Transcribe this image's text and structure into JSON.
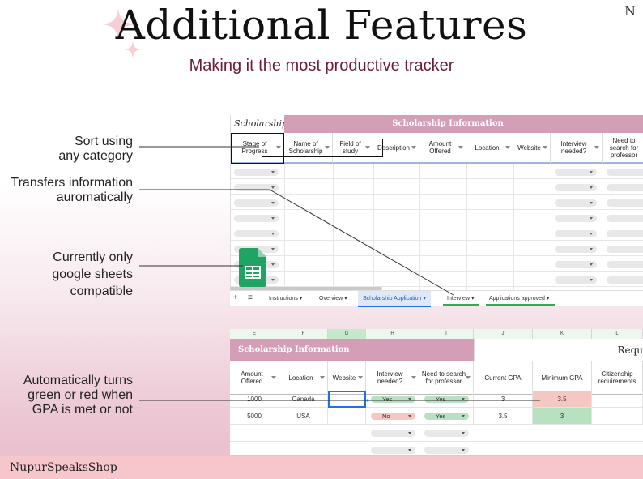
{
  "title": "Additional Features",
  "subtitle": "Making it the most productive tracker",
  "annotations": {
    "sort": [
      "Sort using",
      "any category"
    ],
    "transfer": [
      "Transfers information",
      "auromatically"
    ],
    "compat": [
      "Currently only",
      "google sheets",
      "compatible"
    ],
    "gpa": [
      "Automatically turns",
      "green or red when",
      "GPA is met or not"
    ]
  },
  "sheet1": {
    "logo_text": "Scholarship",
    "banner": "Scholarship Information",
    "headers": [
      "Stage of Progress",
      "Name of Scholarship",
      "Field of study",
      "Description",
      "Amount Offered",
      "Location",
      "Website",
      "Interview needed?",
      "Need to search for professor"
    ]
  },
  "tabs": {
    "add": "+",
    "menu": "≡",
    "items": [
      "Instructions",
      "Overview",
      "Scholarship Application",
      "Interview",
      "Applications approved"
    ]
  },
  "sheet2": {
    "col_letters": [
      "E",
      "F",
      "G",
      "H",
      "I",
      "J",
      "K",
      "L"
    ],
    "banner": "Scholarship Information",
    "banner_right": "Requ",
    "headers": [
      "Amount Offered",
      "Location",
      "Website",
      "Interview needed?",
      "Need to search for professor",
      "Current GPA",
      "Minimum GPA",
      "Citizenship requirements"
    ],
    "rows": [
      {
        "amount": "1000",
        "location": "Canada",
        "website": "",
        "interview": "Yes",
        "professor": "Yes",
        "current_gpa": "3",
        "min_gpa": "3.5",
        "min_status": "unmet"
      },
      {
        "amount": "5000",
        "location": "USA",
        "website": "",
        "interview": "No",
        "professor": "Yes",
        "current_gpa": "3.5",
        "min_gpa": "3",
        "min_status": "met"
      }
    ]
  },
  "footer": {
    "shop": "NupurSpeaksShop",
    "logo": "N"
  },
  "colors": {
    "accent": "#d49fb6",
    "subtitle": "#6e1a35",
    "green": "#b7e1c1",
    "red": "#f4c7c3",
    "yes_pill": "#b7e1c1",
    "no_pill": "#f4c7c3"
  }
}
